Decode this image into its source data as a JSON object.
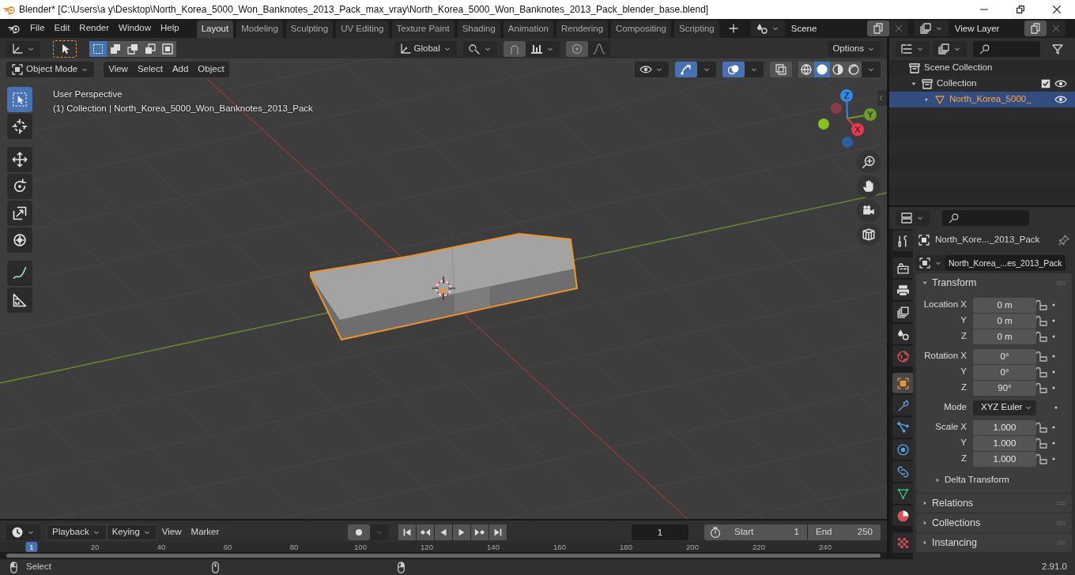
{
  "window": {
    "title": "Blender* [C:\\Users\\a y\\Desktop\\North_Korea_5000_Won_Banknotes_2013_Pack_max_vray\\North_Korea_5000_Won_Banknotes_2013_Pack_blender_base.blend]"
  },
  "menu": [
    "File",
    "Edit",
    "Render",
    "Window",
    "Help"
  ],
  "workspaces": [
    {
      "label": "Layout",
      "selected": true
    },
    {
      "label": "Modeling",
      "selected": false
    },
    {
      "label": "Sculpting",
      "selected": false
    },
    {
      "label": "UV Editing",
      "selected": false
    },
    {
      "label": "Texture Paint",
      "selected": false
    },
    {
      "label": "Shading",
      "selected": false
    },
    {
      "label": "Animation",
      "selected": false
    },
    {
      "label": "Rendering",
      "selected": false
    },
    {
      "label": "Compositing",
      "selected": false
    },
    {
      "label": "Scripting",
      "selected": false
    }
  ],
  "scene": {
    "value": "Scene"
  },
  "view_layer": {
    "value": "View Layer"
  },
  "viewport": {
    "select_modes": [
      {
        "selected": true
      },
      {
        "selected": false
      },
      {
        "selected": false
      },
      {
        "selected": false
      },
      {
        "selected": false
      }
    ],
    "orientation": "Global",
    "options": "Options",
    "mode": "Object Mode",
    "menus": [
      "View",
      "Select",
      "Add",
      "Object"
    ],
    "gizmos_on": true,
    "overlays_on": true,
    "xray_on": false,
    "shading": [
      {
        "kind": "wireframe",
        "selected": false
      },
      {
        "kind": "solid",
        "selected": true
      },
      {
        "kind": "material",
        "selected": false
      },
      {
        "kind": "rendered",
        "selected": false
      }
    ],
    "view_name": "User Perspective",
    "view_info": "(1) Collection | North_Korea_5000_Won_Banknotes_2013_Pack",
    "tools": [
      {
        "kind": "select_box",
        "selected": true
      },
      {
        "kind": "cursor",
        "selected": false
      },
      {
        "kind": "move",
        "selected": false
      },
      {
        "kind": "rotate",
        "selected": false
      },
      {
        "kind": "scale",
        "selected": false
      },
      {
        "kind": "transform",
        "selected": false
      },
      {
        "kind": "annotate",
        "selected": false
      },
      {
        "kind": "measure",
        "selected": false
      }
    ],
    "gizmo": {
      "x": "X",
      "y": "Y",
      "z": "Z"
    }
  },
  "timeline": {
    "menus": [
      {
        "label": "Playback",
        "dropdown": true
      },
      {
        "label": "Keying",
        "dropdown": true
      },
      {
        "label": "View",
        "dropdown": false
      },
      {
        "label": "Marker",
        "dropdown": false
      }
    ],
    "current_frame": "1",
    "start_label": "Start",
    "start": "1",
    "end_label": "End",
    "end": "250",
    "ruler": [
      {
        "label": "1",
        "current": true
      },
      {
        "label": "20",
        "current": false
      },
      {
        "label": "40",
        "current": false
      },
      {
        "label": "60",
        "current": false
      },
      {
        "label": "80",
        "current": false
      },
      {
        "label": "100",
        "current": false
      },
      {
        "label": "120",
        "current": false
      },
      {
        "label": "140",
        "current": false
      },
      {
        "label": "160",
        "current": false
      },
      {
        "label": "180",
        "current": false
      },
      {
        "label": "200",
        "current": false
      },
      {
        "label": "220",
        "current": false
      },
      {
        "label": "240",
        "current": false
      }
    ]
  },
  "outliner": {
    "items": [
      {
        "label": "Scene Collection",
        "kind": "scene_collection",
        "selected": false,
        "children": [
          {
            "label": "Collection",
            "kind": "collection",
            "expanded": true,
            "checked": true,
            "selected": false,
            "children": [
              {
                "label": "North_Korea_5000_",
                "kind": "mesh_object",
                "expanded": false,
                "selected": true
              }
            ]
          }
        ]
      }
    ]
  },
  "properties": {
    "tabs": [
      {
        "kind": "tool",
        "selected": false
      },
      {
        "kind": "render",
        "selected": false
      },
      {
        "kind": "output",
        "selected": false
      },
      {
        "kind": "view_layer",
        "selected": false
      },
      {
        "kind": "scene",
        "selected": false
      },
      {
        "kind": "world",
        "selected": false
      },
      {
        "kind": "object",
        "selected": true
      },
      {
        "kind": "modifiers",
        "selected": false
      },
      {
        "kind": "particles",
        "selected": false
      },
      {
        "kind": "physics",
        "selected": false
      },
      {
        "kind": "constraints",
        "selected": false
      },
      {
        "kind": "data",
        "selected": false
      },
      {
        "kind": "material",
        "selected": false
      },
      {
        "kind": "texture",
        "selected": false
      }
    ],
    "object_name": "North_Kore..._2013_Pack",
    "data_block": "North_Korea_...es_2013_Pack",
    "panels": [
      {
        "label": "Transform",
        "expanded": true,
        "groups": [
          [
            {
              "label": "Location X",
              "value": "0 m",
              "kind": "number"
            },
            {
              "label": "Y",
              "value": "0 m",
              "kind": "number"
            },
            {
              "label": "Z",
              "value": "0 m",
              "kind": "number"
            }
          ],
          [
            {
              "label": "Rotation X",
              "value": "0°",
              "kind": "number"
            },
            {
              "label": "Y",
              "value": "0°",
              "kind": "number"
            },
            {
              "label": "Z",
              "value": "90°",
              "kind": "number"
            }
          ],
          [
            {
              "label": "Mode",
              "value": "XYZ Euler",
              "kind": "dropdown"
            }
          ],
          [
            {
              "label": "Scale X",
              "value": "1.000",
              "kind": "number"
            },
            {
              "label": "Y",
              "value": "1.000",
              "kind": "number"
            },
            {
              "label": "Z",
              "value": "1.000",
              "kind": "number"
            }
          ]
        ],
        "subpanels": [
          {
            "label": "Delta Transform",
            "expanded": false
          }
        ]
      },
      {
        "label": "Relations",
        "expanded": false
      },
      {
        "label": "Collections",
        "expanded": false
      },
      {
        "label": "Instancing",
        "expanded": false
      }
    ]
  },
  "status_bar": {
    "action": "Select",
    "version": "2.91.0"
  }
}
